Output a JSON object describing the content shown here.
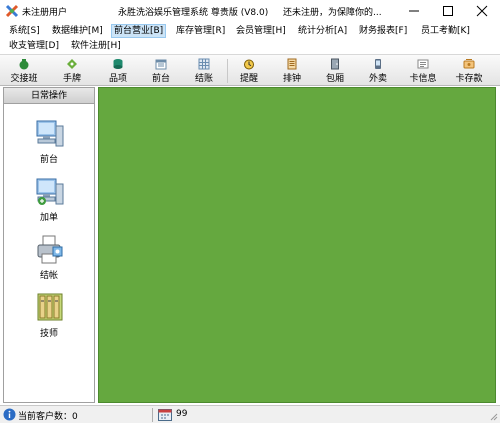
{
  "window": {
    "user": "未注册用户",
    "title": "永胜洗浴娱乐管理系统  尊贵版 (V8.0)",
    "notice": "还未注册，为保障你的..."
  },
  "menu": [
    {
      "label": "系统[S]"
    },
    {
      "label": "数据维护[M]"
    },
    {
      "label": "前台营业[B]",
      "active": true
    },
    {
      "label": "库存管理[R]"
    },
    {
      "label": "会员管理[H]"
    },
    {
      "label": "统计分析[A]"
    },
    {
      "label": "财务报表[F]"
    },
    {
      "label": "员工考勤[K]"
    },
    {
      "label": "收支管理[D]"
    },
    {
      "label": "软件注册[H]"
    }
  ],
  "toolbar": [
    {
      "label": "交接班",
      "icon": "money-bag-icon"
    },
    {
      "label": "手牌",
      "icon": "hand-tag-icon"
    },
    {
      "label": "品项",
      "icon": "items-icon"
    },
    {
      "label": "前台",
      "icon": "front-desk-icon"
    },
    {
      "label": "结账",
      "icon": "checkout-icon"
    },
    {
      "label": "提醒",
      "icon": "reminder-icon"
    },
    {
      "label": "排钟",
      "icon": "schedule-icon"
    },
    {
      "label": "包厢",
      "icon": "private-room-icon"
    },
    {
      "label": "外卖",
      "icon": "takeout-icon"
    },
    {
      "label": "卡信息",
      "icon": "card-info-icon"
    },
    {
      "label": "卡存款",
      "icon": "card-deposit-icon"
    }
  ],
  "sidebar": {
    "title": "日常操作",
    "items": [
      {
        "label": "前台",
        "icon": "computer-icon"
      },
      {
        "label": "加单",
        "icon": "computer-add-icon"
      },
      {
        "label": "结帐",
        "icon": "printer-icon"
      },
      {
        "label": "技师",
        "icon": "technician-books-icon"
      }
    ]
  },
  "status": {
    "customers": "当前客户数：0",
    "value": "99"
  },
  "colors": {
    "workspace": "#65a83f",
    "menu_active_bg": "#cce4f7"
  }
}
